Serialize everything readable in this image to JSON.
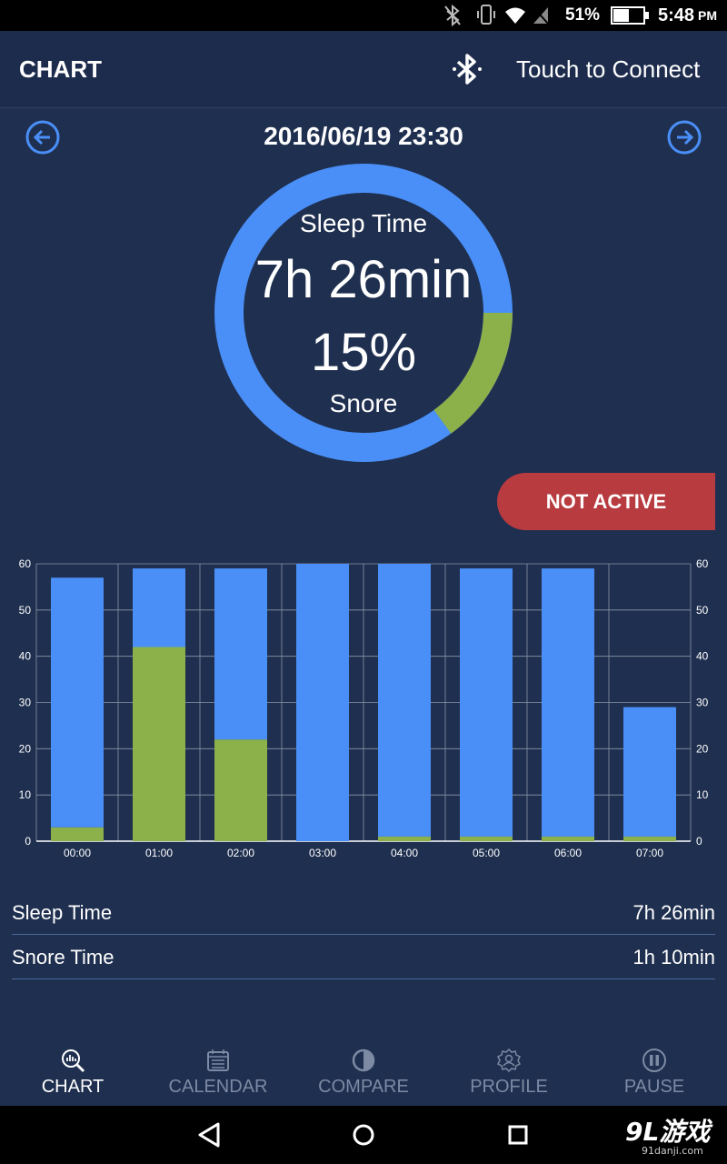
{
  "status_bar": {
    "battery": "51%",
    "time": "5:48",
    "ampm": "PM"
  },
  "app_bar": {
    "title": "CHART",
    "connect_label": "Touch to Connect"
  },
  "header": {
    "date": "2016/06/19 23:30"
  },
  "summary": {
    "label_top": "Sleep Time",
    "duration": "7h 26min",
    "percent": "15%",
    "label_bottom": "Snore",
    "snore_fraction": 0.15
  },
  "status_button": "NOT ACTIVE",
  "chart_data": {
    "type": "bar",
    "stacked": true,
    "categories": [
      "00:00",
      "01:00",
      "02:00",
      "03:00",
      "04:00",
      "05:00",
      "06:00",
      "07:00"
    ],
    "series": [
      {
        "values": [
          3,
          42,
          22,
          0,
          1,
          1,
          1,
          1
        ],
        "color": "#8cb04a"
      },
      {
        "values": [
          54,
          17,
          37,
          60,
          59,
          58,
          58,
          28
        ],
        "color": "#4a8ff7"
      }
    ],
    "ylim": [
      0,
      60
    ],
    "yticks": [
      0,
      10,
      20,
      30,
      40,
      50,
      60
    ],
    "grid": true
  },
  "stats": [
    {
      "label": "Sleep Time",
      "value": "7h 26min"
    },
    {
      "label": "Snore Time",
      "value": "1h 10min"
    }
  ],
  "bottom_nav": [
    {
      "label": "CHART",
      "icon": "chart-icon",
      "active": true
    },
    {
      "label": "CALENDAR",
      "icon": "calendar-icon",
      "active": false
    },
    {
      "label": "COMPARE",
      "icon": "compare-icon",
      "active": false
    },
    {
      "label": "PROFILE",
      "icon": "profile-icon",
      "active": false
    },
    {
      "label": "PAUSE",
      "icon": "pause-icon",
      "active": false
    }
  ],
  "watermark": {
    "brand": "9L游戏",
    "domain": "91danji.com"
  },
  "colors": {
    "sleep": "#4a8ff7",
    "snore": "#8cb04a",
    "background": "#1f2f4f",
    "alert": "#b73b3f"
  }
}
